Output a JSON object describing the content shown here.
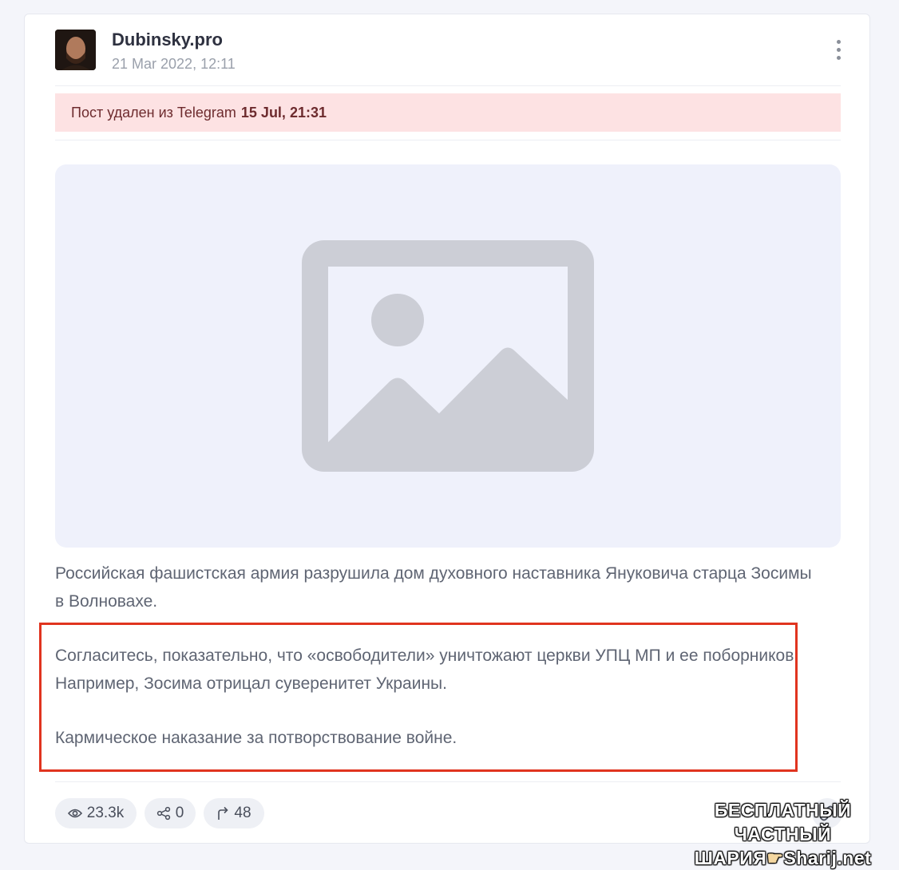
{
  "post": {
    "channel_name": "Dubinsky.pro",
    "date": "21 Mar 2022, 12:11",
    "deleted_notice": {
      "text": "Пост удален из Telegram",
      "date": "15 Jul, 21:31"
    },
    "paragraphs": [
      "Российская фашистская армия разрушила дом духовного наставника Януковича старца Зосимы в Волновахе.",
      "Согласитесь, показательно, что «освободители» уничтожают церкви УПЦ МП и ее поборников. Например, Зосима отрицал суверенитет Украины.",
      "Кармическое наказание за потворствование войне."
    ],
    "stats": {
      "views": "23.3k",
      "shares": "0",
      "forwards": "48"
    }
  },
  "icons": {
    "more": "more-vertical-icon",
    "image_placeholder": "image-placeholder-icon",
    "views": "eye-icon",
    "shares": "share-icon",
    "forwards": "forward-arrow-icon",
    "link": "link-icon"
  },
  "watermark": {
    "line1": "БЕСПЛАТНЫЙ ЧАСТНЫЙ",
    "line2": "ШАРИЯ",
    "line2_site": "Sharij.net"
  },
  "colors": {
    "deleted_banner_bg": "#fde2e3",
    "highlight_border": "#e0341f",
    "media_bg": "#eff1fb"
  }
}
